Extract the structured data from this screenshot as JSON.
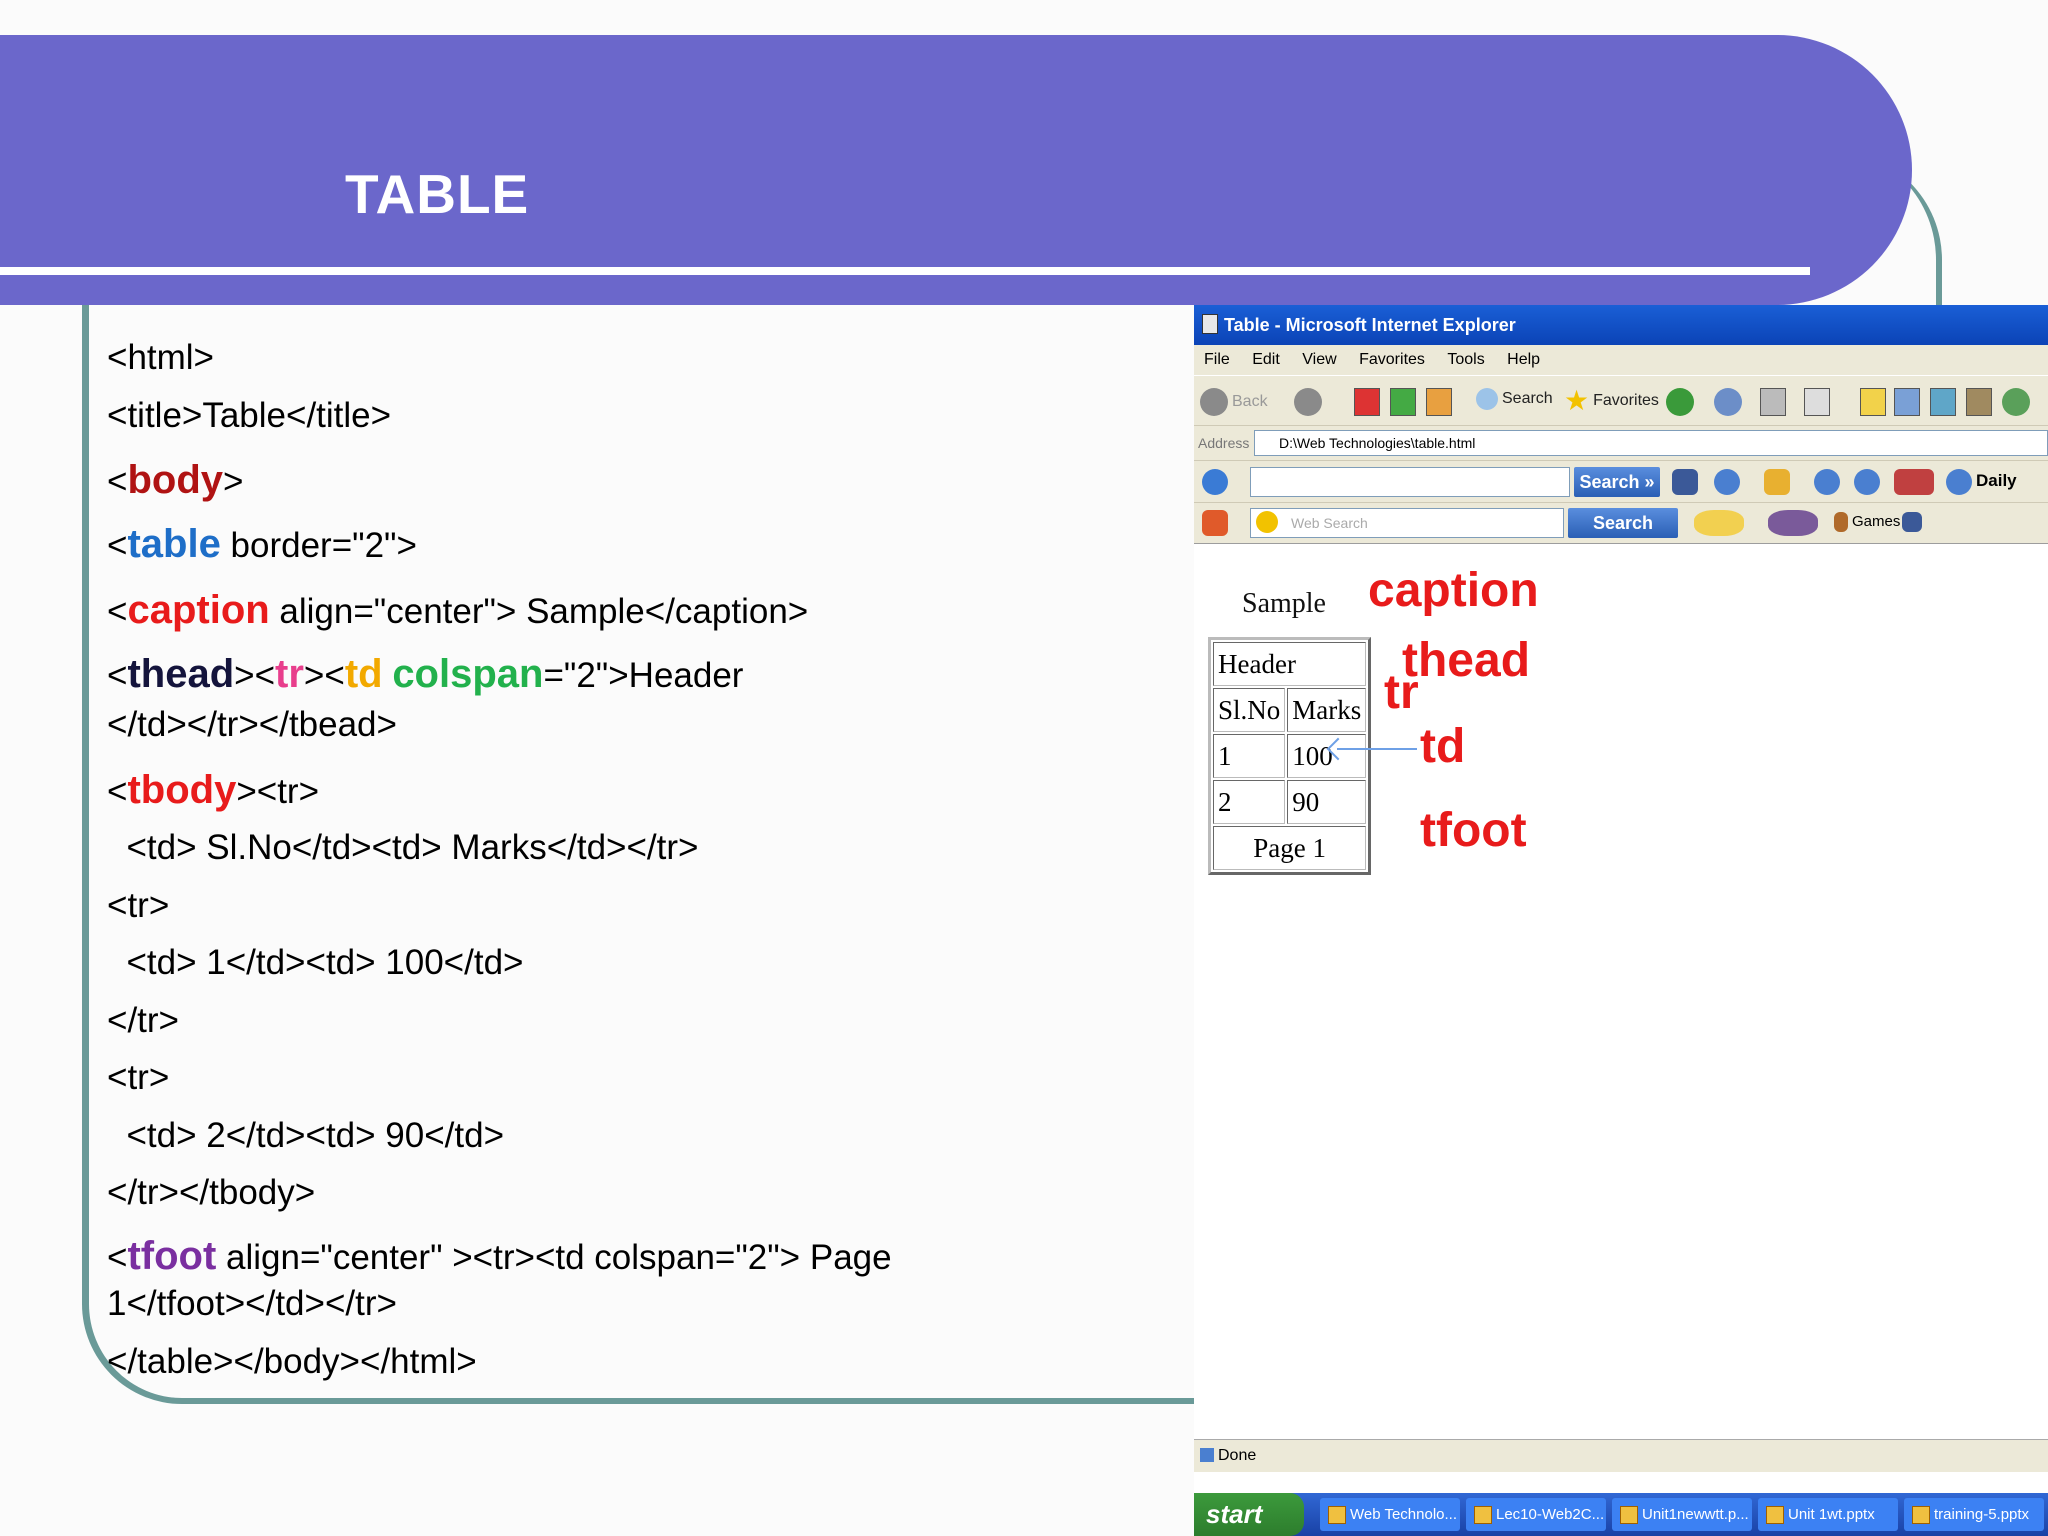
{
  "slide": {
    "title": "TABLE"
  },
  "code_lines": [
    {
      "text": "<html>"
    },
    {
      "text": "<title>Table</title>"
    },
    {
      "pre": "<",
      "kw": "body",
      "post": ">",
      "color": "#b01313"
    },
    {
      "pre": "<",
      "kw": "table",
      "post": " border=\"2\">",
      "color": "#1e6ec8"
    },
    {
      "pre": "<",
      "kw": "caption",
      "post": " align=\"center\"> Sample</caption>",
      "color": "#e81b1b"
    },
    {
      "thead_line": true,
      "pre": "<",
      "kw1": "thead",
      "mid1": "><",
      "kw2": "tr",
      "mid2": "><",
      "kw3": "td",
      "mid3": " ",
      "kw4": "colspan",
      "post": "=\"2\">Header",
      "c1": "#14143c",
      "c2": "#e83e8c",
      "c3": "#f2a900",
      "c4": "#22b14c"
    },
    {
      "text": "</td></tr></tbead>"
    },
    {
      "pre": "<",
      "kw": "tbody",
      "post": "><tr>",
      "color": "#e81b1b"
    },
    {
      "text": "  <td> Sl.No</td><td> Marks</td></tr>"
    },
    {
      "text": "<tr>"
    },
    {
      "text": "  <td> 1</td><td> 100</td>"
    },
    {
      "text": "</tr>"
    },
    {
      "text": "<tr>"
    },
    {
      "text": "  <td> 2</td><td> 90</td>"
    },
    {
      "text": "</tr></tbody>"
    },
    {
      "pre": "<",
      "kw": "tfoot",
      "post": " align=\"center\" ><tr><td colspan=\"2\"> Page",
      "color": "#7a2fa0"
    },
    {
      "text": "1</tfoot></td></tr>"
    },
    {
      "text": "</table></body></html>"
    }
  ],
  "browser": {
    "title": "Table - Microsoft Internet Explorer",
    "menu": [
      "File",
      "Edit",
      "View",
      "Favorites",
      "Tools",
      "Help"
    ],
    "toolbar": {
      "back": "Back",
      "search": "Search",
      "favorites": "Favorites"
    },
    "address_label": "Address",
    "address_value": "D:\\Web Technologies\\table.html",
    "search_button": "Search »",
    "daily_label": "Daily",
    "web_search_placeholder": "Web Search",
    "search_button2": "Search",
    "games_label": "Games",
    "status": "Done",
    "taskbar": {
      "start": "start",
      "items": [
        "Web Technolo...",
        "Lec10-Web2C...",
        "Unit1newwtt.p...",
        "Unit 1wt.pptx",
        "training-5.pptx"
      ]
    }
  },
  "rendered_table": {
    "caption": "Sample",
    "header": "Header",
    "col_headers": [
      "Sl.No",
      "Marks"
    ],
    "rows": [
      [
        "1",
        "100"
      ],
      [
        "2",
        "90"
      ]
    ],
    "footer": "Page 1"
  },
  "annotations": {
    "caption": "caption",
    "thead": "thead",
    "tr": "tr",
    "td": "td",
    "tfoot": "tfoot"
  }
}
